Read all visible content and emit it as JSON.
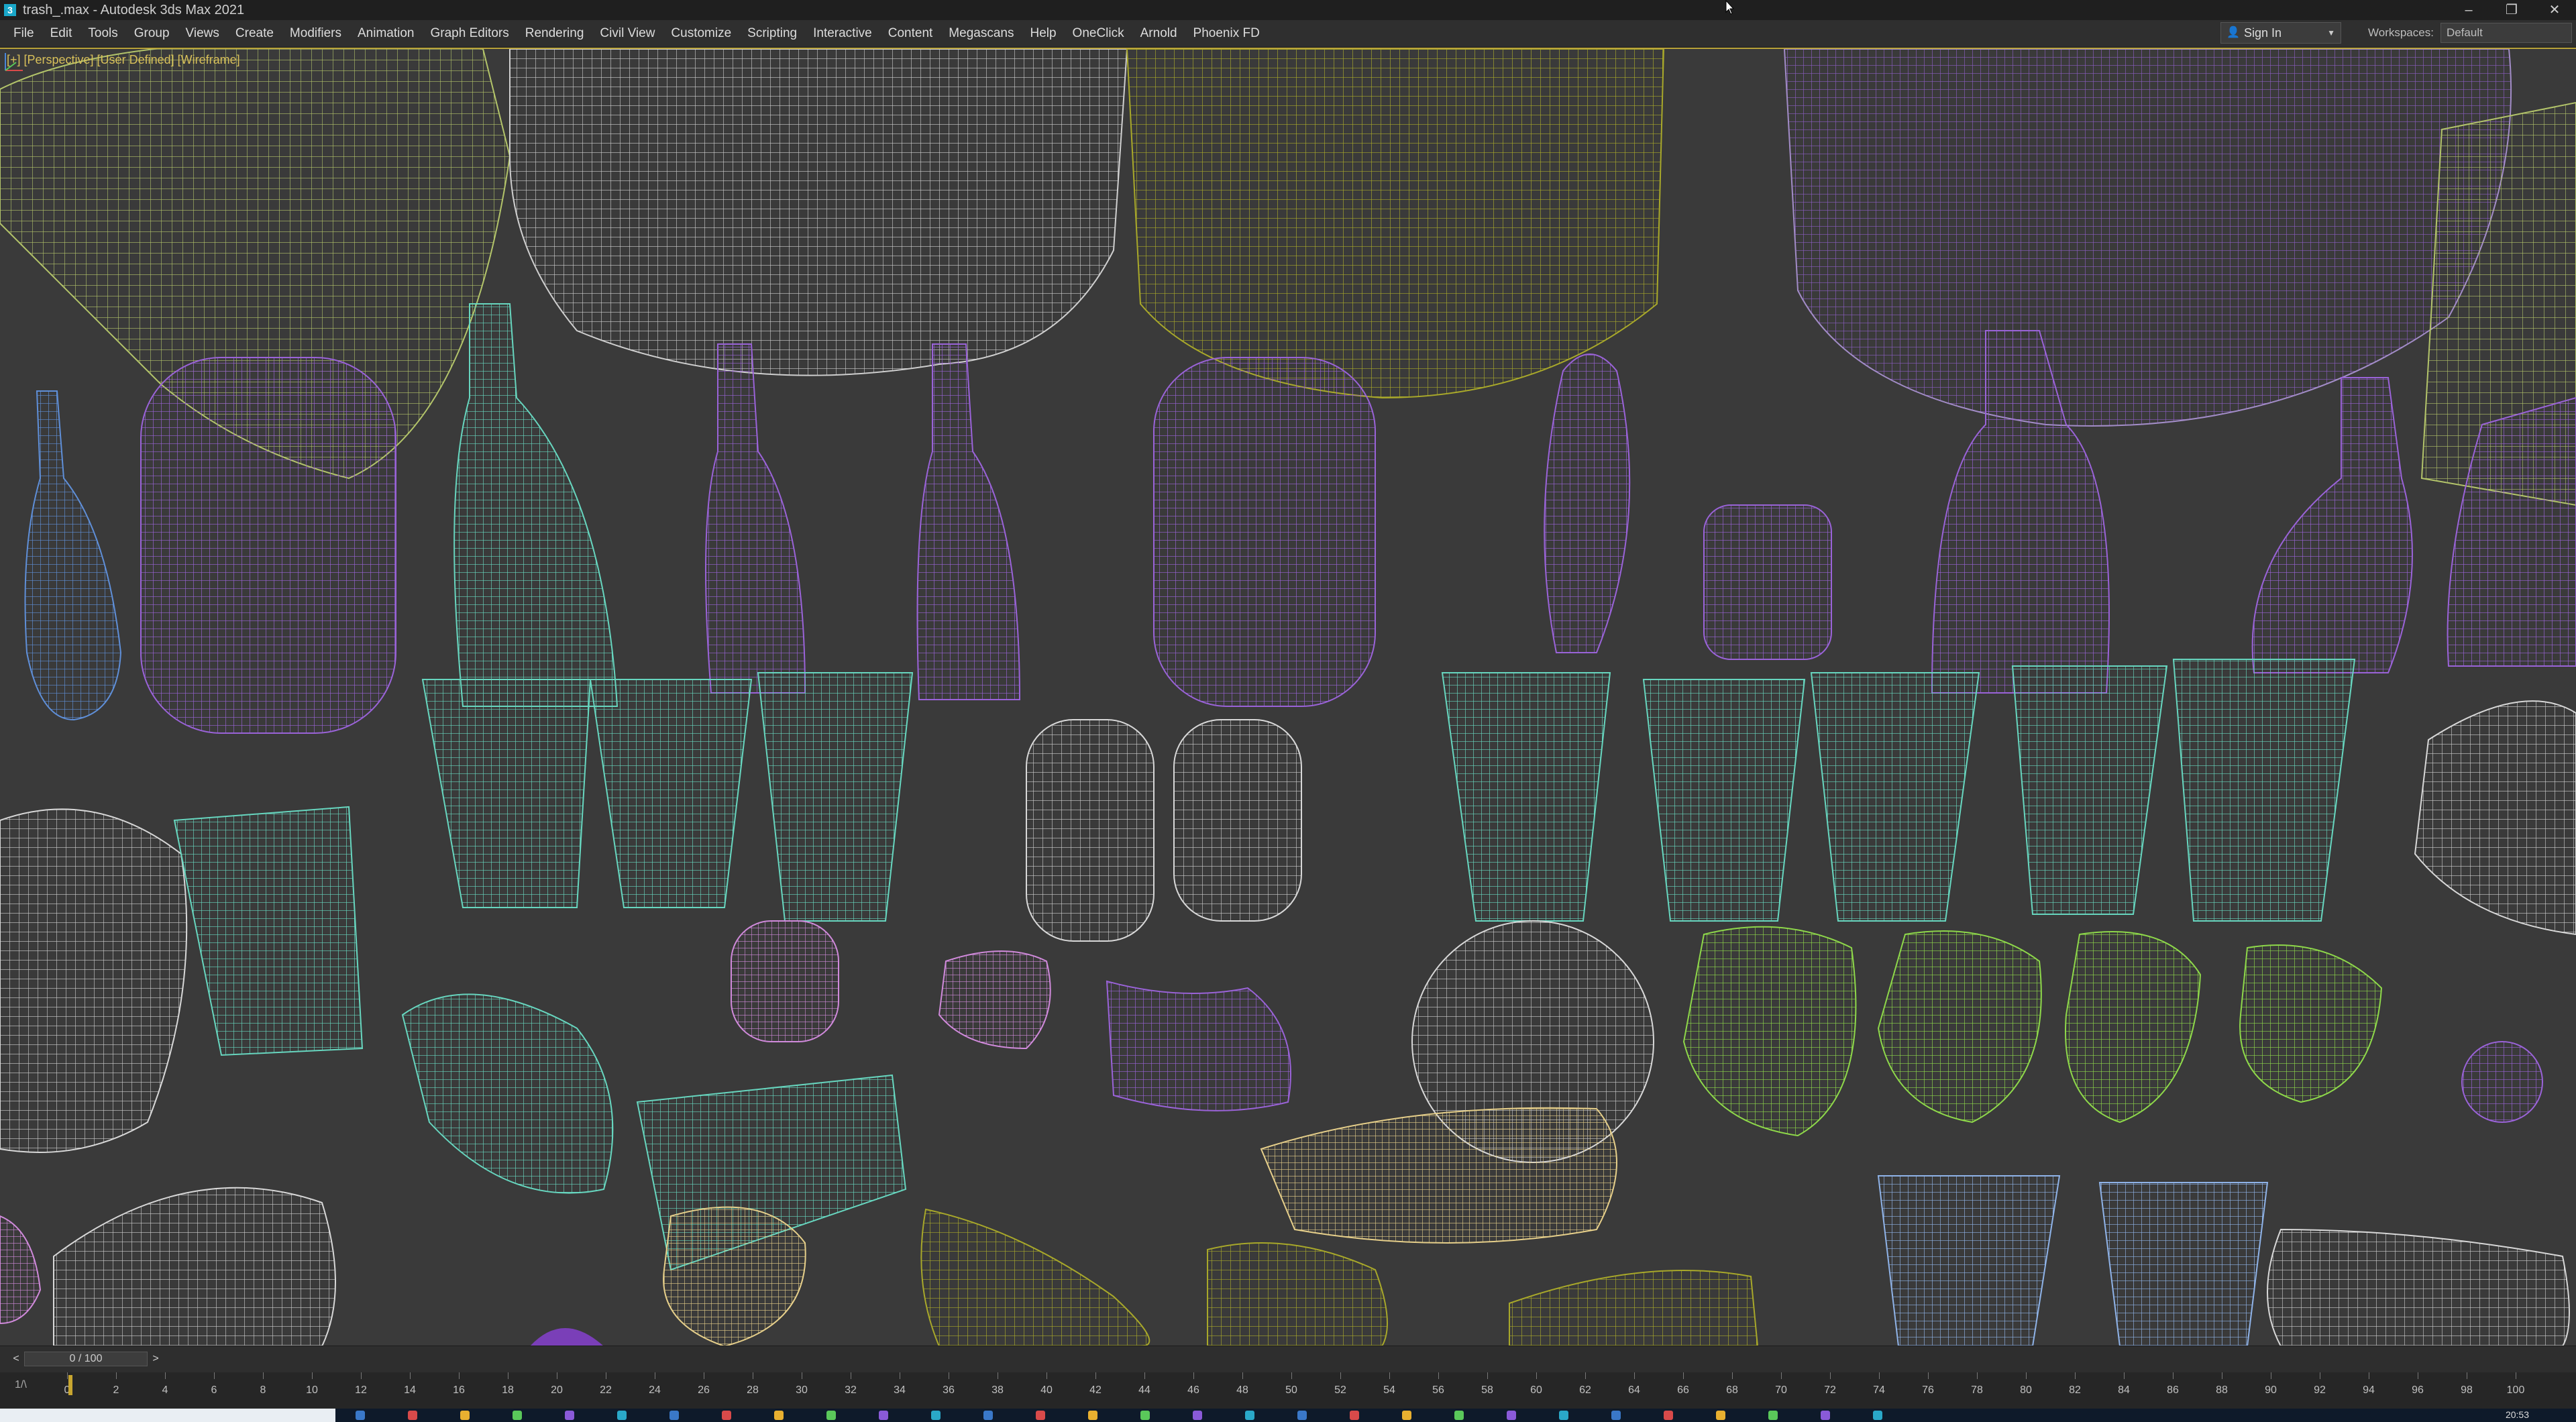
{
  "window": {
    "title": "trash_.max - Autodesk 3ds Max 2021",
    "minimize": "–",
    "maximize": "❐",
    "close": "✕"
  },
  "menubar": {
    "items": [
      "File",
      "Edit",
      "Tools",
      "Group",
      "Views",
      "Create",
      "Modifiers",
      "Animation",
      "Graph Editors",
      "Rendering",
      "Civil View",
      "Customize",
      "Scripting",
      "Interactive",
      "Content",
      "Megascans",
      "Help",
      "OneClick",
      "Arnold",
      "Phoenix FD"
    ]
  },
  "account": {
    "signin_label": "Sign In",
    "workspaces_label": "Workspaces:",
    "workspace_value": "Default"
  },
  "viewport": {
    "label": "[+] [Perspective] [User Defined] [Wireframe]",
    "accent": "#b9a33a"
  },
  "timeslider": {
    "position_label": "0 / 100",
    "prev": "<",
    "next": ">"
  },
  "trackbar": {
    "mode_label": "1/\\",
    "ticks": [
      "0",
      "2",
      "4",
      "6",
      "8",
      "10",
      "12",
      "14",
      "16",
      "18",
      "20",
      "22",
      "24",
      "26",
      "28",
      "30",
      "32",
      "34",
      "36",
      "38",
      "40",
      "42",
      "44",
      "46",
      "48",
      "50",
      "52",
      "54",
      "56",
      "58",
      "60",
      "62",
      "64",
      "66",
      "68",
      "70",
      "72",
      "74",
      "76",
      "78",
      "80",
      "82",
      "84",
      "86",
      "88",
      "90",
      "92",
      "94",
      "96",
      "98",
      "100"
    ]
  },
  "taskbar": {
    "clock": "20:53"
  },
  "colors": {
    "purple": "#9a63d8",
    "teal": "#67d6bf",
    "white": "#d8d8d8",
    "lime": "#8ed84a",
    "olive": "#a8a82a",
    "yellow_green": "#b3c46a",
    "peach": "#e6cf8a",
    "blue": "#5f8fd8",
    "light_blue": "#8fb3e8",
    "pink": "#d08adb"
  }
}
